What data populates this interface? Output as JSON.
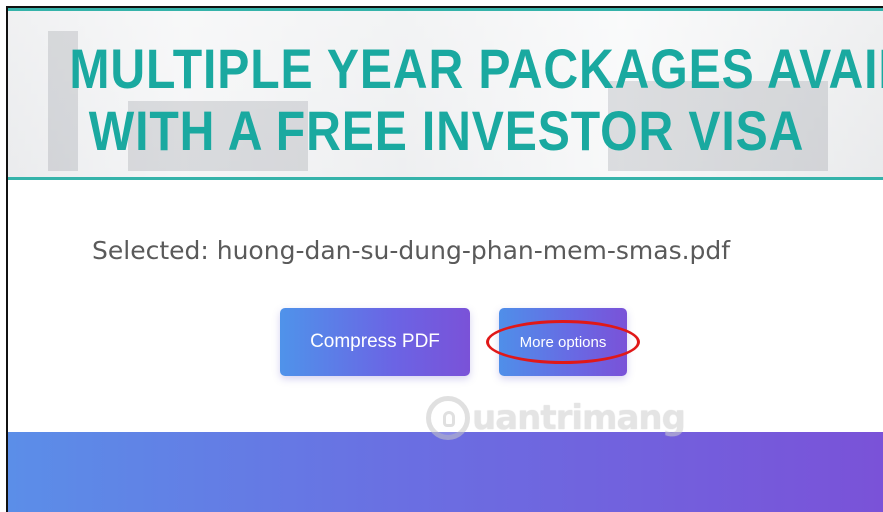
{
  "banner": {
    "line1": "MULTIPLE YEAR PACKAGES AVAILABLE",
    "line2": "WITH A FREE INVESTOR VISA",
    "text_color": "#1aa9a0",
    "border_color": "#35b3aa"
  },
  "selected_file": {
    "text": "Selected: huong-dan-su-dung-phan-mem-smas.pdf"
  },
  "buttons": {
    "compress_label": "Compress PDF",
    "more_options_label": "More options"
  },
  "annotation": {
    "highlight_color": "#e01818"
  },
  "watermark": {
    "text": "uantrimang",
    "icon": "lightbulb-icon"
  },
  "colors": {
    "gradient_start": "#4f93ea",
    "gradient_end": "#7a52d8"
  }
}
